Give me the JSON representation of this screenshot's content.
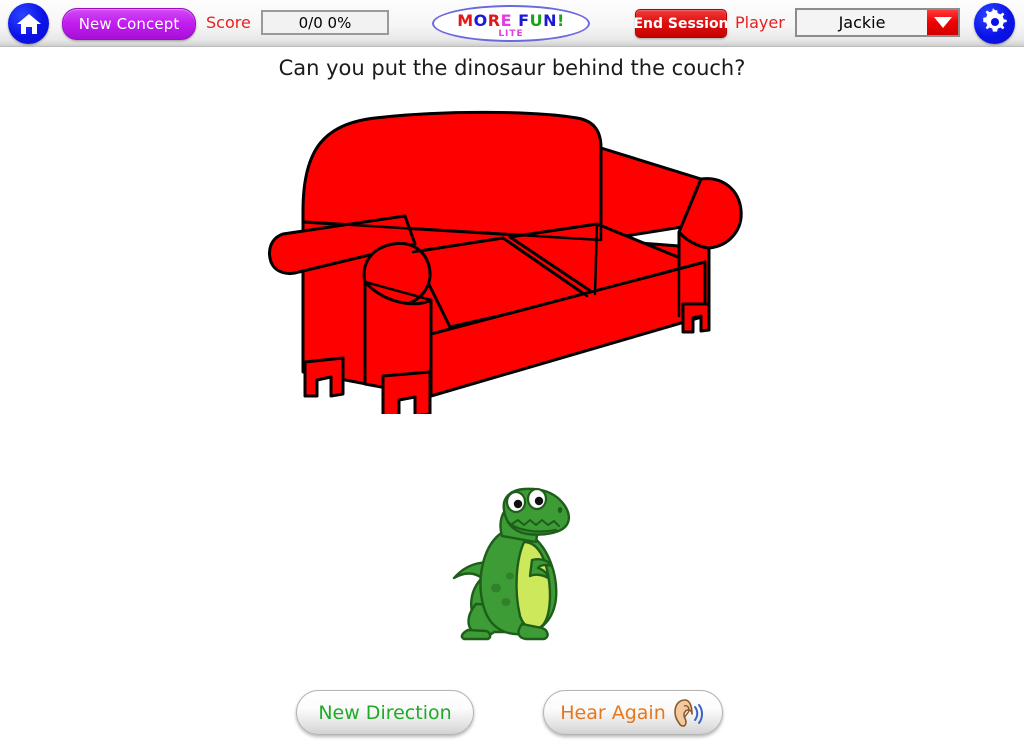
{
  "app": {
    "logo_main_text": "MORE FUN!",
    "logo_sub_text": "LITE",
    "logo_letters": [
      {
        "ch": "M",
        "color": "#e01818"
      },
      {
        "ch": "O",
        "color": "#1a1ad6"
      },
      {
        "ch": "R",
        "color": "#e01818"
      },
      {
        "ch": "E",
        "color": "#e43ce4"
      },
      {
        "ch": " ",
        "color": "#000000"
      },
      {
        "ch": "F",
        "color": "#1a1ad6"
      },
      {
        "ch": "U",
        "color": "#17a417"
      },
      {
        "ch": "N",
        "color": "#1a1ad6"
      },
      {
        "ch": "!",
        "color": "#17a417"
      }
    ]
  },
  "toolbar": {
    "home_icon": "home-icon",
    "home_tooltip": "Home",
    "new_concept_label": "New Concept",
    "score_label": "Score",
    "score_value": "0/0  0%",
    "end_session_label": "End Session",
    "player_label": "Player",
    "player_value": "Jackie",
    "player_options": [
      "Jackie"
    ],
    "dropdown_icon": "chevron-down-icon",
    "settings_icon": "gear-icon"
  },
  "prompt": {
    "text": "Can you put the dinosaur behind the couch?"
  },
  "stage": {
    "objects": [
      {
        "name": "couch",
        "label": "couch",
        "color": "#ff0000",
        "outline": "#000000"
      },
      {
        "name": "dinosaur",
        "label": "dinosaur",
        "color": "#3d9c35",
        "belly_color": "#cde85a",
        "outline": "#1f5e1a"
      }
    ]
  },
  "footer": {
    "new_direction_label": "New Direction",
    "hear_again_label": "Hear Again",
    "hear_again_icon": "ear-icon"
  },
  "colors": {
    "toolbar_bg": "#f3f3f3",
    "accent_blue": "#0b12e8",
    "accent_red": "#e62020",
    "accent_purple": "#c21ff0",
    "accent_green": "#1faa28",
    "accent_orange": "#e8761a",
    "couch_red": "#ff0000",
    "dino_green": "#3d9c35"
  }
}
